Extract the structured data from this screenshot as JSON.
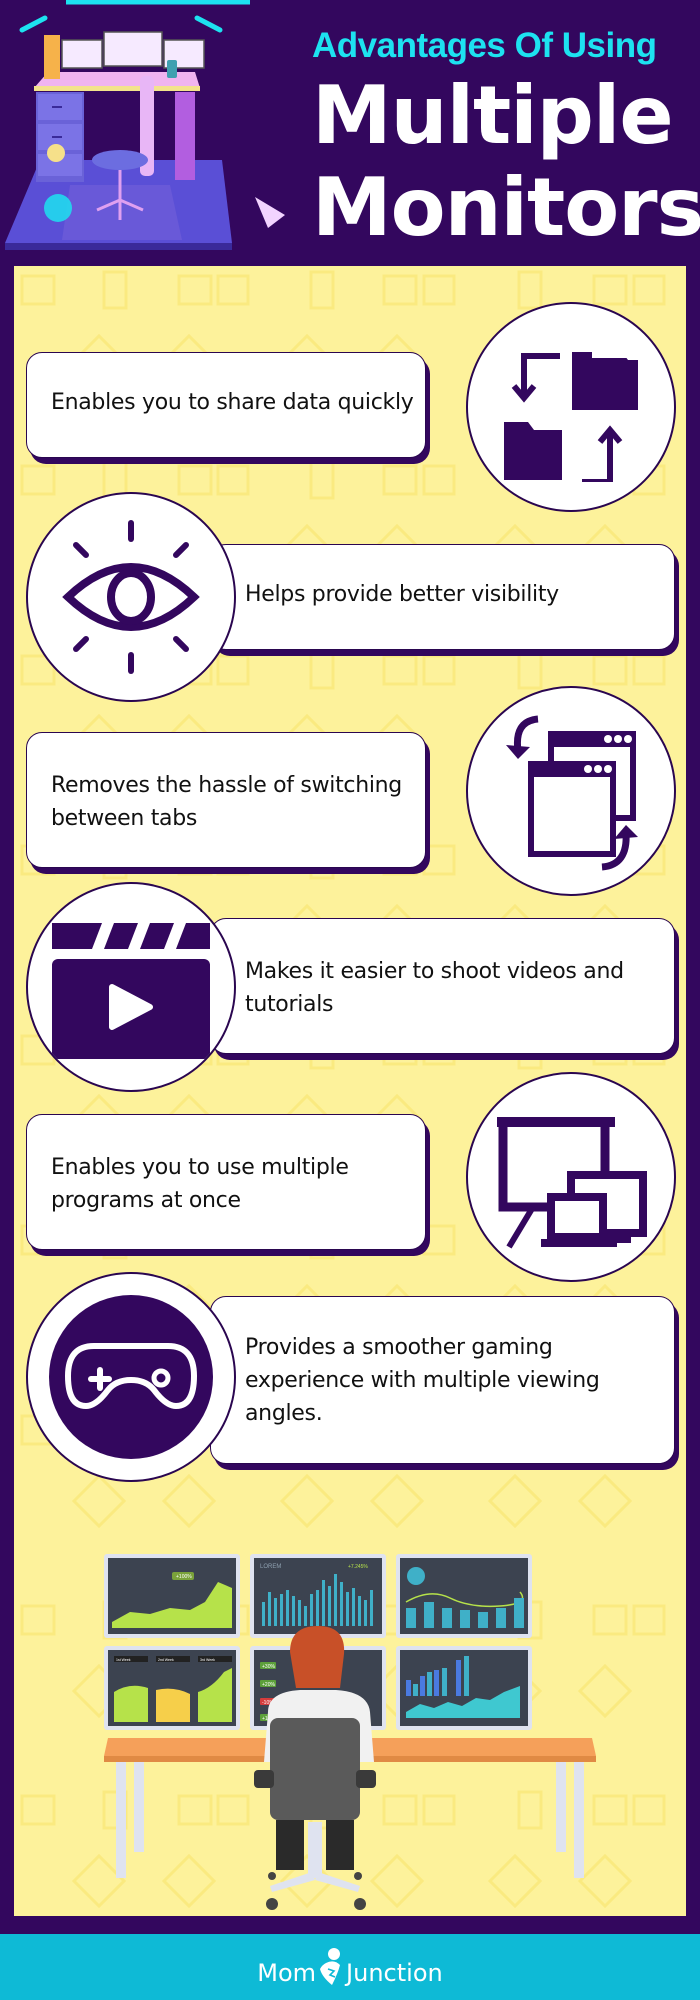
{
  "header": {
    "subtitle": "Advantages Of Using",
    "title_line1": "Multiple",
    "title_line2": "Monitors",
    "colors": {
      "background": "#33075e",
      "subtitle": "#1de2f0",
      "title": "#ffffff"
    }
  },
  "items": [
    {
      "text": "Enables you to share data quickly",
      "icon": "folder-transfer-icon"
    },
    {
      "text": "Helps provide better visibility",
      "icon": "eye-icon"
    },
    {
      "text": "Removes the hassle of switching between tabs",
      "icon": "switch-windows-icon"
    },
    {
      "text": "Makes it easier to shoot videos and tutorials",
      "icon": "video-clapper-icon"
    },
    {
      "text": "Enables you to use multiple programs at once",
      "icon": "multiple-screens-icon"
    },
    {
      "text": "Provides a smoother gaming experience with multiple viewing angles.",
      "icon": "gamepad-icon"
    }
  ],
  "illustration": {
    "screen_labels": [
      "+100%",
      "LOREM",
      "+7.245%",
      "1st Week",
      "2nd Week",
      "3rd Week",
      "+30%",
      "+20%",
      "-10%",
      "+15%"
    ]
  },
  "footer": {
    "brand_left": "Mom",
    "brand_right": "Junction"
  },
  "colors": {
    "panel": "#fdf29b",
    "accent_purple": "#33075e",
    "footer": "#0ebad6"
  }
}
